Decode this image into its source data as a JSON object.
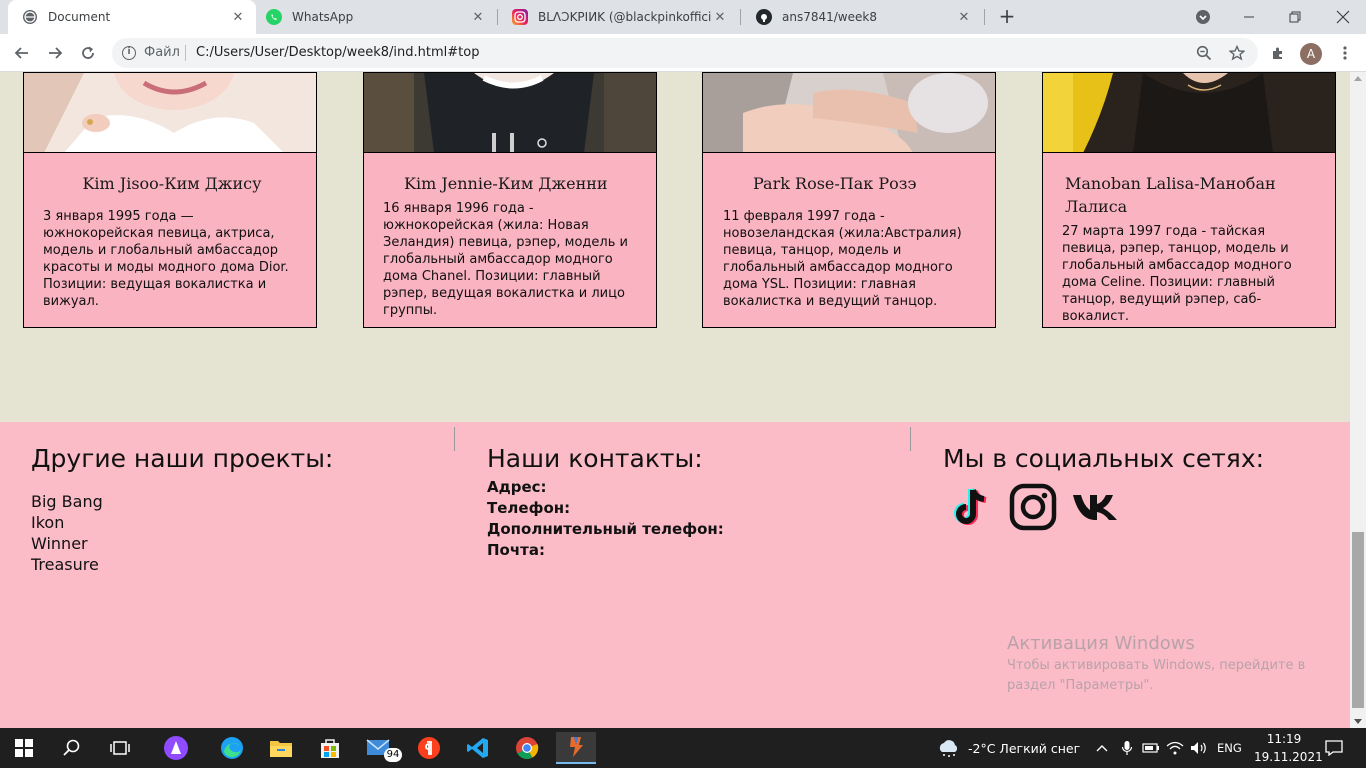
{
  "browser": {
    "tabs": [
      {
        "title": "Document"
      },
      {
        "title": "WhatsApp"
      },
      {
        "title": "BLΛƆKPIИK (@blackpinkofficial) ·"
      },
      {
        "title": "ans7841/week8"
      }
    ],
    "file_label": "Файл",
    "url": "C:/Users/User/Desktop/week8/ind.html#top",
    "profile_initial": "A"
  },
  "members": [
    {
      "name": "Kim Jisoo-Ким Джису",
      "bio": "3 января 1995 года — южнокорейская певица, актриса, модель и глобальный амбассадор красоты и моды модного дома Dior. Позиции: ведущая вокалистка и вижуал."
    },
    {
      "name": "Kim Jennie-Ким Дженни",
      "bio": "16 января 1996 года - южнокорейская (жила: Новая Зеландия) певица, рэпер, модель и глобальный амбассадор модного дома Chanel. Позиции: главный рэпер, ведущая вокалистка и лицо группы."
    },
    {
      "name": "Park Rose-Пак Розэ",
      "bio": "11 февраля 1997 года - новозеландская (жила:Австралия) певица, танцор, модель и глобальный амбассадор модного дома YSL. Позиции: главная вокалистка и ведущий танцор."
    },
    {
      "name": "Manoban Lalisa-Манобан Лалиса",
      "bio": "27 марта 1997 года - тайская певица, рэпер, танцор, модель и глобальный амбассадор модного дома Celine. Позиции: главный танцор, ведущий рэпер, саб-вокалист."
    }
  ],
  "footer": {
    "projects_title": "Другие наши проекты:",
    "projects": [
      "Big Bang",
      "Ikon",
      "Winner",
      "Treasure"
    ],
    "contacts_title": "Наши контакты:",
    "contacts": [
      "Адрес:",
      "Телефон:",
      "Дополнительный телефон:",
      "Почта:"
    ],
    "social_title": "Мы в социальных сетях:",
    "social_icons": [
      "tiktok-icon",
      "instagram-icon",
      "vk-icon"
    ]
  },
  "watermark": {
    "title": "Активация Windows",
    "line1": "Чтобы активировать Windows, перейдите в",
    "line2": "раздел \"Параметры\"."
  },
  "taskbar": {
    "mail_badge": "94",
    "weather": "-2°C  Легкий снег",
    "lang": "ENG",
    "time": "11:19",
    "date": "19.11.2021"
  }
}
